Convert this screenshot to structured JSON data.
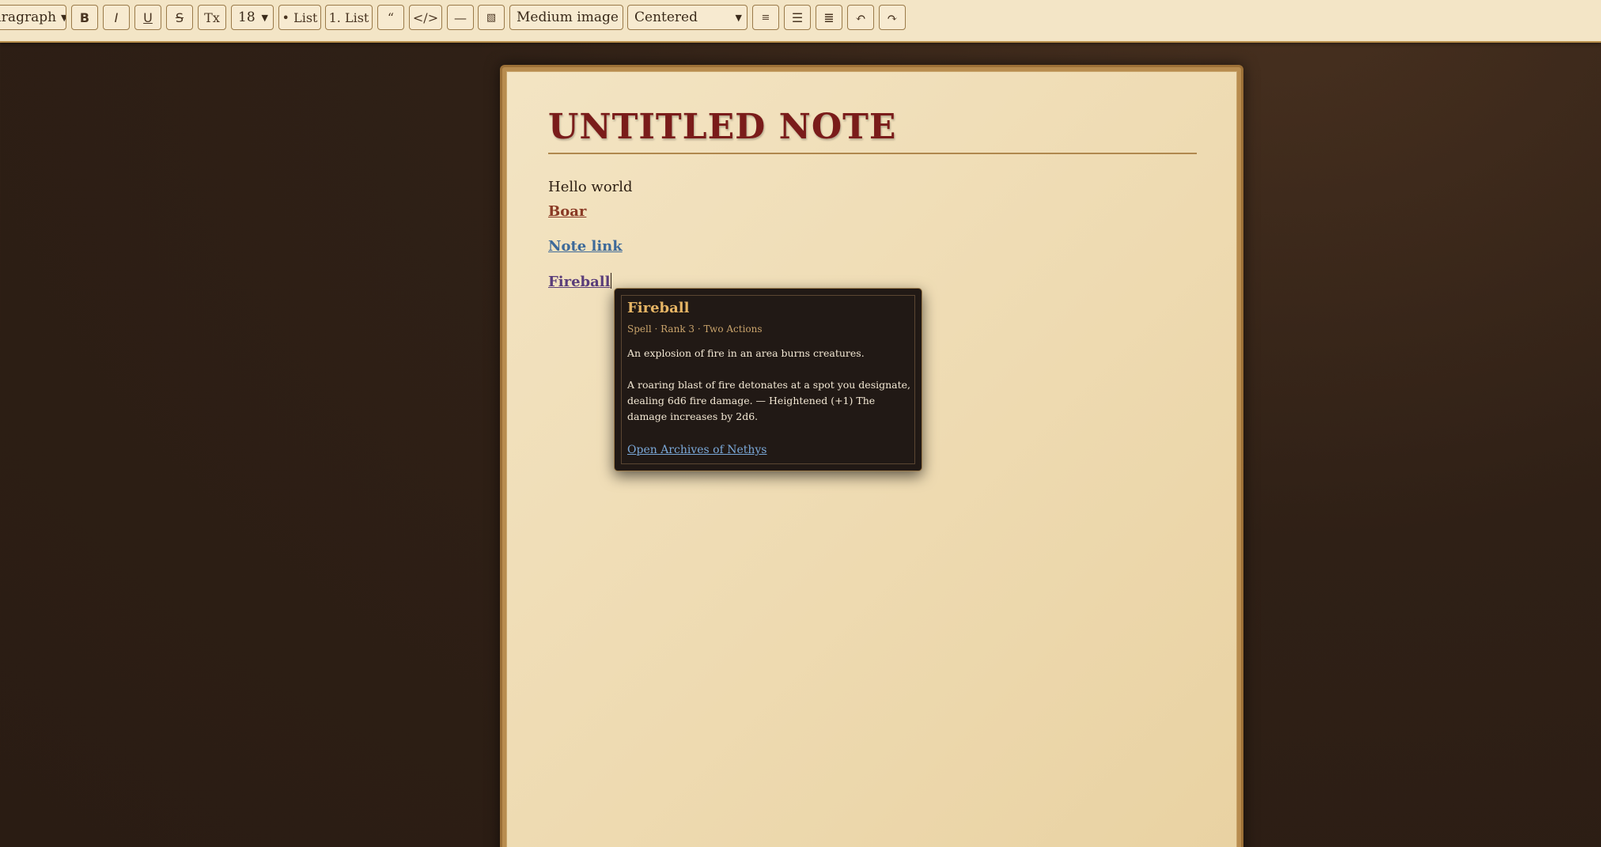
{
  "toolbar": {
    "block_format": "Paragraph",
    "bold_label": "B",
    "italic_label": "I",
    "underline_label": "U",
    "strike_label": "S",
    "clear_format_label": "Tx",
    "font_size": "18",
    "bullet_list_label": "• List",
    "numbered_list_label": "1. List",
    "quote_label": "“",
    "code_label": "</>",
    "hr_label": "—",
    "image_label": "▧",
    "image_size": "Medium image",
    "image_align": "Centered",
    "align_left_label": "≡",
    "align_center_label": "☰",
    "align_justify_label": "≣",
    "undo_label": "↶",
    "redo_label": "↷"
  },
  "note": {
    "title": "UNTITLED NOTE",
    "text_line": "Hello world",
    "links": {
      "boar": "Boar",
      "note_link": "Note link",
      "fireball": "Fireball"
    }
  },
  "tooltip": {
    "title": "Fireball",
    "meta": "Spell · Rank 3 · Two Actions",
    "summary": "An explosion of fire in an area burns creatures.",
    "body": "A roaring blast of fire detonates at a spot you designate, dealing 6d6 fire damage. — Heightened (+1) The damage increases by 2d6.",
    "link": "Open Archives of Nethys"
  },
  "colors": {
    "title": "#7a1c1a",
    "link_creature": "#8a3a25",
    "link_note": "#3e6a9a",
    "link_spell": "#5a3d7a",
    "tooltip_bg": "#211915",
    "tooltip_title": "#e6b565",
    "tooltip_link": "#7aa8d8"
  }
}
